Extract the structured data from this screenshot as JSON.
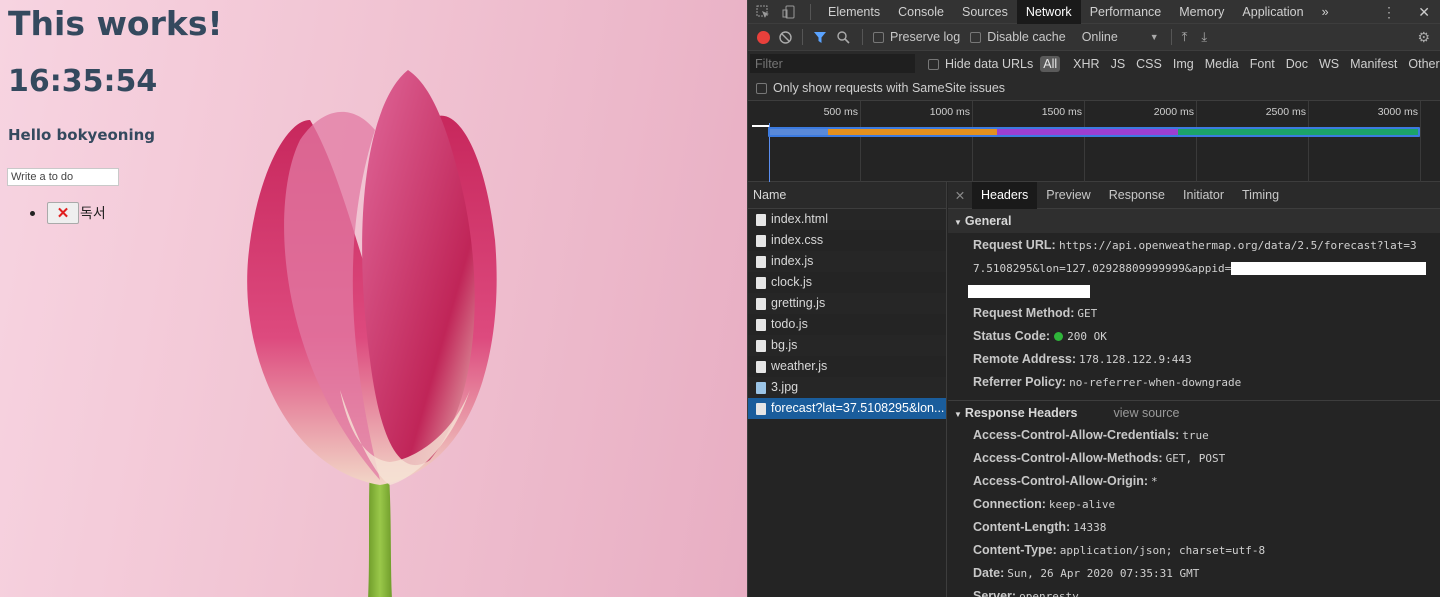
{
  "page": {
    "title": "This works!",
    "clock": "16:35:54",
    "greeting": "Hello bokyeoning",
    "todo_placeholder": "Write a to do",
    "todos": [
      {
        "delete": "✕",
        "text": "독서"
      }
    ]
  },
  "devtools": {
    "tabs": [
      "Elements",
      "Console",
      "Sources",
      "Network",
      "Performance",
      "Memory",
      "Application"
    ],
    "more_tabs": "»",
    "toolbar": {
      "preserve_log": "Preserve log",
      "disable_cache": "Disable cache",
      "throttle": "Online"
    },
    "filter": {
      "placeholder": "Filter",
      "hide_data_urls": "Hide data URLs",
      "types": [
        "All",
        "XHR",
        "JS",
        "CSS",
        "Img",
        "Media",
        "Font",
        "Doc",
        "WS",
        "Manifest",
        "Other"
      ],
      "samesite": "Only show requests with SameSite issues"
    },
    "timeline": {
      "ticks": [
        "500 ms",
        "1000 ms",
        "1500 ms",
        "2000 ms",
        "2500 ms",
        "3000 ms"
      ],
      "segments": [
        {
          "color": "#5a8ad9",
          "fraction": 0.09
        },
        {
          "color": "#e3901f",
          "fraction": 0.26
        },
        {
          "color": "#9c3fd1",
          "fraction": 0.28
        },
        {
          "color": "#1ca36a",
          "fraction": 0.37
        }
      ]
    },
    "requests": {
      "header": "Name",
      "items": [
        "index.html",
        "index.css",
        "index.js",
        "clock.js",
        "gretting.js",
        "todo.js",
        "bg.js",
        "weather.js",
        "3.jpg",
        "forecast?lat=37.5108295&lon..."
      ]
    },
    "details": {
      "tabs": [
        "Headers",
        "Preview",
        "Response",
        "Initiator",
        "Timing"
      ],
      "general": {
        "title": "General",
        "request_url_key": "Request URL:",
        "request_url": "https://api.openweathermap.org/data/2.5/forecast?lat=37.5108295&lon=127.02928809999999&appid=",
        "request_method_key": "Request Method:",
        "request_method": "GET",
        "status_code_key": "Status Code:",
        "status_code": "200 OK",
        "remote_address_key": "Remote Address:",
        "remote_address": "178.128.122.9:443",
        "referrer_policy_key": "Referrer Policy:",
        "referrer_policy": "no-referrer-when-downgrade"
      },
      "response_headers": {
        "title": "Response Headers",
        "view_source": "view source",
        "items": [
          {
            "k": "Access-Control-Allow-Credentials:",
            "v": "true"
          },
          {
            "k": "Access-Control-Allow-Methods:",
            "v": "GET, POST"
          },
          {
            "k": "Access-Control-Allow-Origin:",
            "v": "*"
          },
          {
            "k": "Connection:",
            "v": "keep-alive"
          },
          {
            "k": "Content-Length:",
            "v": "14338"
          },
          {
            "k": "Content-Type:",
            "v": "application/json; charset=utf-8"
          },
          {
            "k": "Date:",
            "v": "Sun, 26 Apr 2020 07:35:31 GMT"
          },
          {
            "k": "Server:",
            "v": "openresty"
          }
        ]
      }
    }
  }
}
